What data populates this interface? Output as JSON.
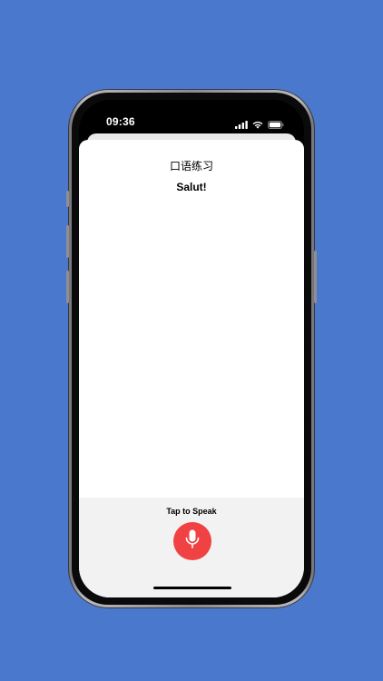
{
  "status_bar": {
    "time": "09:36"
  },
  "sheet": {
    "title": "口语练习",
    "phrase": "Salut!"
  },
  "speak_panel": {
    "label": "Tap to Speak",
    "mic_icon": "microphone-icon",
    "button_color": "#f04242"
  },
  "colors": {
    "background": "#4a78cc",
    "accent": "#f04242"
  }
}
